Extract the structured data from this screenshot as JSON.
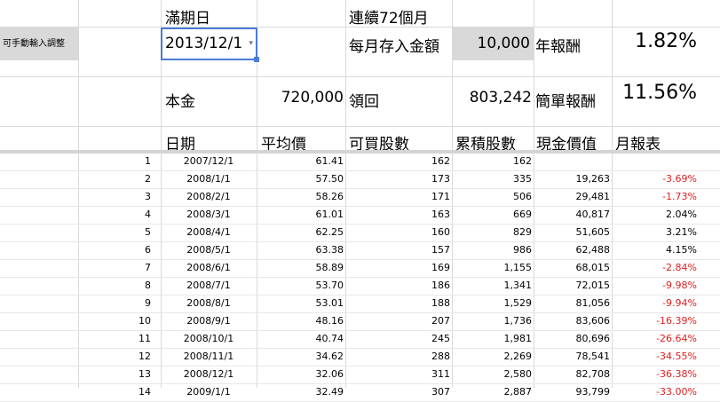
{
  "header": {
    "maturity_label": "滿期日",
    "months_label": "連續72個月",
    "manual_label": "可手動輸入調整",
    "maturity_value": "2013/12/1",
    "monthly_label": "每月存入金額",
    "monthly_value": "10,000",
    "annual_label": "年報酬",
    "annual_value": "1.82%",
    "principal_label": "本金",
    "principal_value": "720,000",
    "withdraw_label": "領回",
    "withdraw_value": "803,242",
    "simple_label": "簡單報酬",
    "simple_value": "11.56%"
  },
  "columns": [
    "日期",
    "平均價",
    "可買股數",
    "累積股數",
    "現金價值",
    "月報表"
  ],
  "rows": [
    {
      "n": "1",
      "date": "2007/12/1",
      "price": "61.41",
      "buy": "162",
      "acc": "162",
      "cash": "",
      "pct": ""
    },
    {
      "n": "2",
      "date": "2008/1/1",
      "price": "57.50",
      "buy": "173",
      "acc": "335",
      "cash": "19,263",
      "pct": "-3.69%"
    },
    {
      "n": "3",
      "date": "2008/2/1",
      "price": "58.26",
      "buy": "171",
      "acc": "506",
      "cash": "29,481",
      "pct": "-1.73%"
    },
    {
      "n": "4",
      "date": "2008/3/1",
      "price": "61.01",
      "buy": "163",
      "acc": "669",
      "cash": "40,817",
      "pct": "2.04%"
    },
    {
      "n": "5",
      "date": "2008/4/1",
      "price": "62.25",
      "buy": "160",
      "acc": "829",
      "cash": "51,605",
      "pct": "3.21%"
    },
    {
      "n": "6",
      "date": "2008/5/1",
      "price": "63.38",
      "buy": "157",
      "acc": "986",
      "cash": "62,488",
      "pct": "4.15%"
    },
    {
      "n": "7",
      "date": "2008/6/1",
      "price": "58.89",
      "buy": "169",
      "acc": "1,155",
      "cash": "68,015",
      "pct": "-2.84%"
    },
    {
      "n": "8",
      "date": "2008/7/1",
      "price": "53.70",
      "buy": "186",
      "acc": "1,341",
      "cash": "72,015",
      "pct": "-9.98%"
    },
    {
      "n": "9",
      "date": "2008/8/1",
      "price": "53.01",
      "buy": "188",
      "acc": "1,529",
      "cash": "81,056",
      "pct": "-9.94%"
    },
    {
      "n": "10",
      "date": "2008/9/1",
      "price": "48.16",
      "buy": "207",
      "acc": "1,736",
      "cash": "83,606",
      "pct": "-16.39%"
    },
    {
      "n": "11",
      "date": "2008/10/1",
      "price": "40.74",
      "buy": "245",
      "acc": "1,981",
      "cash": "80,696",
      "pct": "-26.64%"
    },
    {
      "n": "12",
      "date": "2008/11/1",
      "price": "34.62",
      "buy": "288",
      "acc": "2,269",
      "cash": "78,541",
      "pct": "-34.55%"
    },
    {
      "n": "13",
      "date": "2008/12/1",
      "price": "32.06",
      "buy": "311",
      "acc": "2,580",
      "cash": "82,708",
      "pct": "-36.38%"
    },
    {
      "n": "14",
      "date": "2009/1/1",
      "price": "32.49",
      "buy": "307",
      "acc": "2,887",
      "cash": "93,799",
      "pct": "-33.00%"
    }
  ],
  "colors": {
    "negative": "#e02020",
    "grid": "#d9d9d9",
    "input_bg": "#d9d9d9",
    "selection": "#4a7bd6"
  },
  "icons": {
    "dropdown": "chevron-down-icon"
  }
}
